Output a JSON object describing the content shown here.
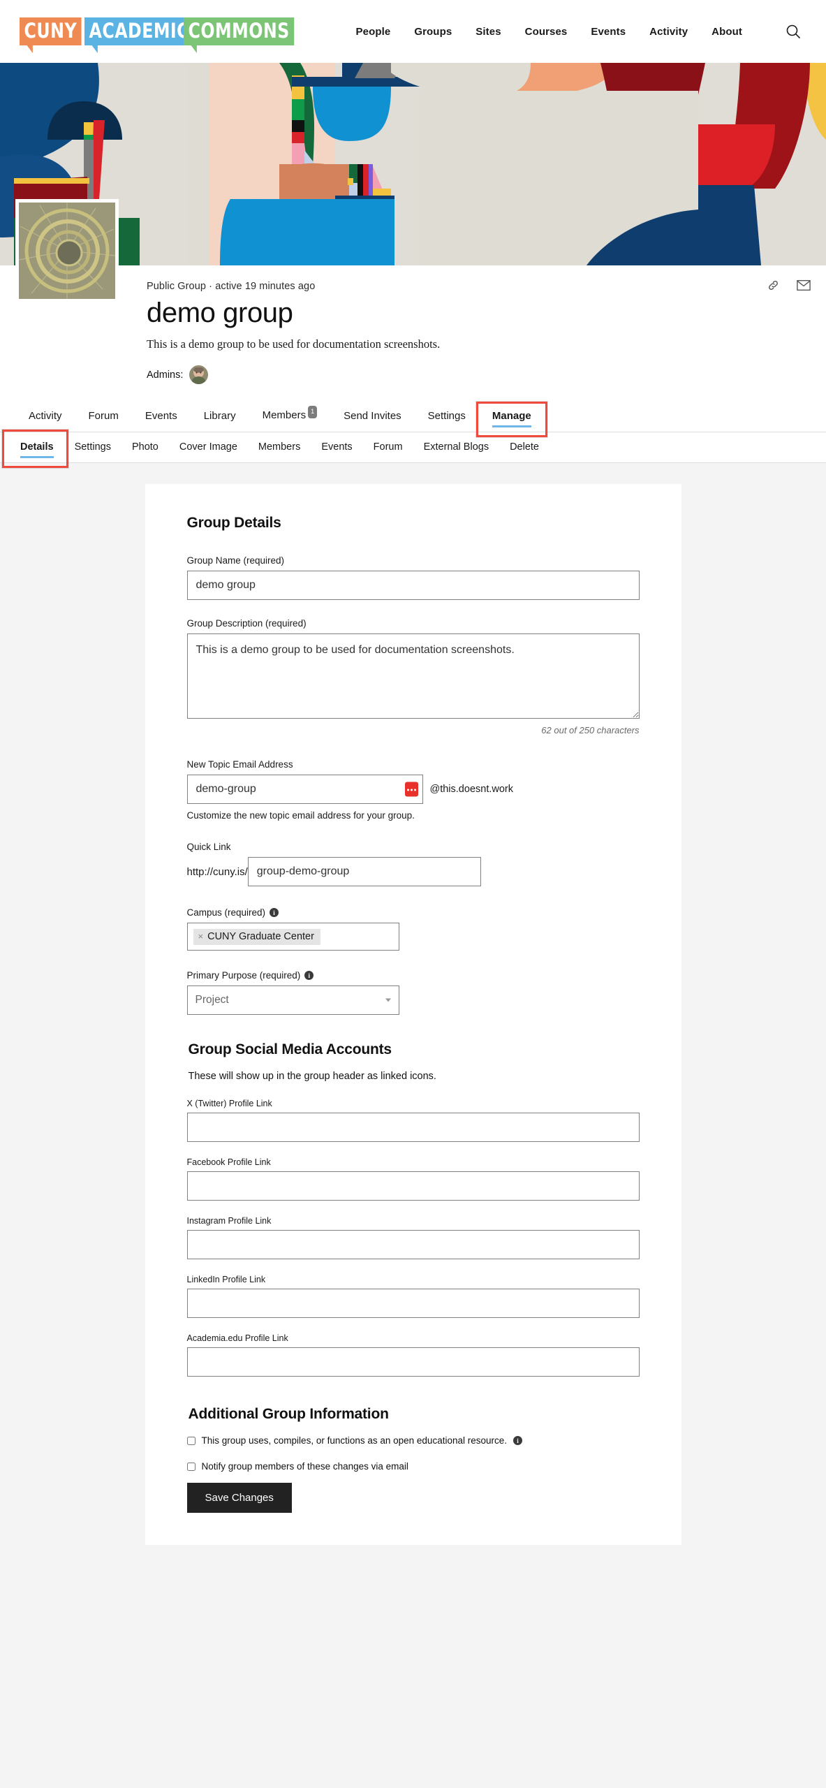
{
  "site": {
    "logo_parts": [
      "CUNY",
      "ACADEMIC",
      "COMMONS"
    ],
    "logo_colors": [
      "#ef8b52",
      "#5bb3e4",
      "#7cc576"
    ],
    "nav": [
      {
        "label": "People"
      },
      {
        "label": "Groups"
      },
      {
        "label": "Sites"
      },
      {
        "label": "Courses"
      },
      {
        "label": "Events"
      },
      {
        "label": "Activity"
      },
      {
        "label": "About"
      }
    ],
    "search_icon": "search-icon"
  },
  "group": {
    "meta_line": "Public Group · active 19 minutes ago",
    "title": "demo group",
    "description": "This is a demo group to be used for documentation screenshots.",
    "admins_label": "Admins:",
    "header_icons": [
      "link-icon",
      "envelope-icon"
    ]
  },
  "group_tabs": [
    {
      "label": "Activity",
      "active": false
    },
    {
      "label": "Forum",
      "active": false
    },
    {
      "label": "Events",
      "active": false
    },
    {
      "label": "Library",
      "active": false
    },
    {
      "label": "Members",
      "active": false,
      "badge": "1"
    },
    {
      "label": "Send Invites",
      "active": false
    },
    {
      "label": "Settings",
      "active": false
    },
    {
      "label": "Manage",
      "active": true,
      "annotated": true
    }
  ],
  "manage_tabs": [
    {
      "label": "Details",
      "active": true,
      "annotated": true
    },
    {
      "label": "Settings",
      "active": false
    },
    {
      "label": "Photo",
      "active": false
    },
    {
      "label": "Cover Image",
      "active": false
    },
    {
      "label": "Members",
      "active": false
    },
    {
      "label": "Events",
      "active": false
    },
    {
      "label": "Forum",
      "active": false
    },
    {
      "label": "External Blogs",
      "active": false
    },
    {
      "label": "Delete",
      "active": false
    }
  ],
  "form": {
    "section_details_title": "Group Details",
    "group_name_label": "Group Name (required)",
    "group_name_value": "demo group",
    "group_desc_label": "Group Description (required)",
    "group_desc_value": "This is a demo group to be used for documentation screenshots.",
    "char_count": "62 out of 250 characters",
    "email_label": "New Topic Email Address",
    "email_value": "demo-group",
    "email_suffix": "@this.doesnt.work",
    "email_help": "Customize the new topic email address for your group.",
    "quick_link_label": "Quick Link",
    "quick_link_prefix": "http://cuny.is/",
    "quick_link_value": "group-demo-group",
    "campus_label": "Campus (required)",
    "campus_token": "CUNY Graduate Center",
    "campus_token_remove": "×",
    "purpose_label": "Primary Purpose (required)",
    "purpose_value": "Project",
    "section_social_title": "Group Social Media Accounts",
    "social_desc": "These will show up in the group header as linked icons.",
    "social_fields": [
      {
        "label": "X (Twitter) Profile Link",
        "value": ""
      },
      {
        "label": "Facebook Profile Link",
        "value": ""
      },
      {
        "label": "Instagram Profile Link",
        "value": ""
      },
      {
        "label": "LinkedIn Profile Link",
        "value": ""
      },
      {
        "label": "Academia.edu Profile Link",
        "value": ""
      }
    ],
    "section_additional_title": "Additional Group Information",
    "checkbox_oer": "This group uses, compiles, or functions as an open educational resource.",
    "checkbox_notify": "Notify group members of these changes via email",
    "save_label": "Save Changes"
  },
  "colors": {
    "accent_underline": "#6fb7e8",
    "annotation": "#f04a3c",
    "page_bg": "#f4f4f4",
    "button_bg": "#222222"
  }
}
